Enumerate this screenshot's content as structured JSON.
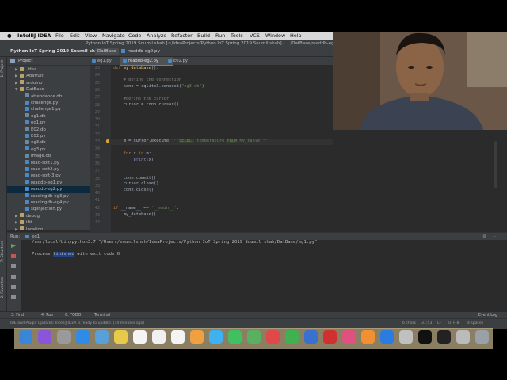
{
  "menubar": {
    "app_name": "IntelliJ IDEA",
    "items": [
      "File",
      "Edit",
      "View",
      "Navigate",
      "Code",
      "Analyze",
      "Refactor",
      "Build",
      "Run",
      "Tools",
      "VCS",
      "Window",
      "Help"
    ]
  },
  "window": {
    "title": "Python IoT Spring 2019 Soumil shah [~/IdeaProjects/Python IoT Spring 2019 Soumil shah] - .../DatBase/readdb-eg2.py"
  },
  "navbar": {
    "project": "Python IoT Spring 2019 Soumil shah",
    "folder": "DatBase",
    "file": "readdb-eg2.py"
  },
  "project_panel": {
    "header": "Project",
    "items": [
      {
        "label": ".idea",
        "kind": "folder",
        "depth": 1,
        "expandable": true
      },
      {
        "label": "Adafruit",
        "kind": "folder",
        "depth": 1,
        "expandable": true
      },
      {
        "label": "arduino",
        "kind": "folder",
        "depth": 1,
        "expandable": true
      },
      {
        "label": "DatBase",
        "kind": "folder",
        "depth": 1,
        "expandable": true,
        "expanded": true
      },
      {
        "label": "attendance.db",
        "kind": "db",
        "depth": 2
      },
      {
        "label": "challenge.py",
        "kind": "py",
        "depth": 2
      },
      {
        "label": "challenge1.py",
        "kind": "py",
        "depth": 2
      },
      {
        "label": "eg1.db",
        "kind": "db",
        "depth": 2
      },
      {
        "label": "eg1.py",
        "kind": "py",
        "depth": 2
      },
      {
        "label": "E02.db",
        "kind": "db",
        "depth": 2
      },
      {
        "label": "E02.py",
        "kind": "py",
        "depth": 2
      },
      {
        "label": "eg3.db",
        "kind": "db",
        "depth": 2
      },
      {
        "label": "eg3.py",
        "kind": "py",
        "depth": 2
      },
      {
        "label": "image.db",
        "kind": "db",
        "depth": 2
      },
      {
        "label": "read-soft1.py",
        "kind": "py",
        "depth": 2
      },
      {
        "label": "read-soft2.py",
        "kind": "py",
        "depth": 2
      },
      {
        "label": "read-soft-3.py",
        "kind": "py",
        "depth": 2
      },
      {
        "label": "readdb-eg1.py",
        "kind": "py",
        "depth": 2
      },
      {
        "label": "readdb-eg2.py",
        "kind": "py",
        "depth": 2,
        "selected": true
      },
      {
        "label": "readingdb-eg3.py",
        "kind": "py",
        "depth": 2
      },
      {
        "label": "readingdb-eg4.py",
        "kind": "py",
        "depth": 2
      },
      {
        "label": "sqlinjection.py",
        "kind": "py",
        "depth": 2
      },
      {
        "label": "debug",
        "kind": "folder",
        "depth": 1,
        "expandable": true
      },
      {
        "label": "iftt",
        "kind": "folder",
        "depth": 1,
        "expandable": true
      },
      {
        "label": "location",
        "kind": "folder",
        "depth": 1,
        "expandable": true
      }
    ]
  },
  "left_strip": {
    "project_tab": "1: Project",
    "structure_tab": "7: Structure",
    "favorites_tab": "2: Favorites"
  },
  "editor": {
    "tabs": [
      {
        "label": "eg1.py",
        "active": false
      },
      {
        "label": "readdb-eg2.py",
        "active": true
      },
      {
        "label": "E02.py",
        "active": false
      }
    ],
    "line_numbers": [
      "23",
      "24",
      "25",
      "26",
      "27",
      "28",
      "29",
      "30",
      "31",
      "32",
      "33",
      "34",
      "35",
      "36",
      "37",
      "38",
      "39",
      "40",
      "41",
      "42",
      "43",
      "44"
    ],
    "breadcrumb": "my_database()"
  },
  "run_panel": {
    "label": "Run:",
    "config": "eg1",
    "command": "/usr/local/bin/python3.7 \"/Users/soumilshah/IdeaProjects/Python IoT Spring 2019 Soumil shah/DatBase/eg1.py\"",
    "exit_prefix": "Process ",
    "exit_word": "finished",
    "exit_suffix": " with exit code 0"
  },
  "bottom_tools": {
    "find": "3: Find",
    "run": "4: Run",
    "todo": "6: TODO",
    "terminal": "Terminal",
    "event_log": "Event Log"
  },
  "status": {
    "message": "IDE and Plugin Updates: IntelliJ IDEA is ready to update. (14 minutes ago)",
    "chars": "6 chars",
    "position": "31:53",
    "line_sep": "LF",
    "encoding": "UTF-8",
    "indent": "4 spaces"
  },
  "colors": {
    "editor_bg": "#2b2b2b",
    "panel_bg": "#3c3f41",
    "keyword": "#cc7832",
    "string": "#6a8759",
    "function": "#ffc66d",
    "comment": "#808080",
    "selection": "#0d293e"
  },
  "dock": {
    "icons": [
      "finder-icon",
      "siri-icon",
      "launchpad-icon",
      "safari-icon",
      "preview-icon",
      "notes-icon",
      "calendar-icon",
      "reminders-icon",
      "textedit-icon",
      "photos-icon",
      "messages-icon",
      "facetime-icon",
      "maps-icon",
      "news-icon",
      "numbers-icon",
      "keynote-icon",
      "block-icon",
      "itunes-icon",
      "books-icon",
      "appstore-icon",
      "help-icon",
      "intellij-icon",
      "obs-icon",
      "database-icon",
      "trash-icon"
    ]
  }
}
